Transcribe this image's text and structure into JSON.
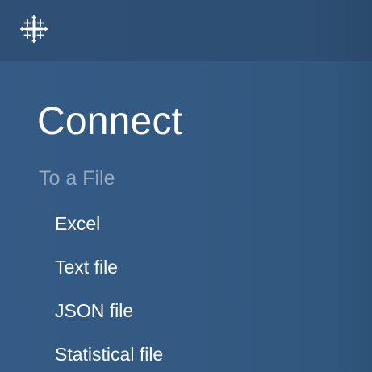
{
  "header": {
    "logo_icon": "tableau-cross-logo-icon",
    "colors": {
      "topbar": "#2f4f74",
      "panel": "#335b85",
      "text": "#ffffff",
      "muted_heading": "#97aac0"
    }
  },
  "connect": {
    "title": "Connect",
    "section_heading": "To a File",
    "items": [
      {
        "label": "Excel"
      },
      {
        "label": "Text file"
      },
      {
        "label": "JSON file"
      },
      {
        "label": "Statistical file"
      }
    ]
  }
}
